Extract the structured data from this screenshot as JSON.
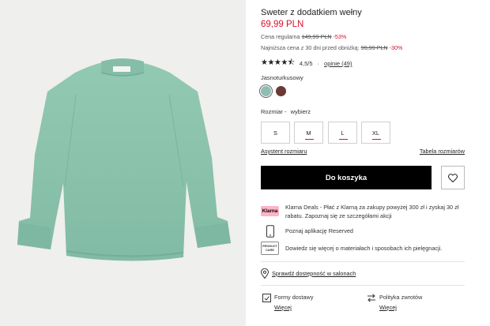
{
  "product": {
    "title": "Sweter z dodatkiem wełny",
    "price": "69,99 PLN",
    "regular_label": "Cena regularna",
    "regular_price": "149,99 PLN",
    "regular_discount": "-53%",
    "lowest_label": "Najniższa cena z 30 dni przed obniżką:",
    "lowest_price": "99,99 PLN",
    "lowest_discount": "-30%",
    "rating_value": "4,5/5",
    "rating_sep": "·",
    "reviews_link": "opinie (49)",
    "stars": "★★★★⯪"
  },
  "colors": {
    "selected_name": "Jasnoturkusowy",
    "swatches": [
      "#8fbdb2",
      "#6b3a34"
    ]
  },
  "sizes": {
    "label": "Rozmiar -",
    "hint": "wybierz",
    "options": [
      "S",
      "M",
      "L",
      "XL"
    ]
  },
  "links": {
    "size_assistant": "Asystent rozmiaru",
    "size_chart": "Tabela rozmiarów"
  },
  "cart": {
    "button_label": "Do koszyka"
  },
  "info": {
    "klarna_logo": "Klarna",
    "klarna_text": "Klarna Deals - Płać z Klarną za zakupy powyżej 300 zł i zyskaj 30 zł rabatu. Zapoznaj się ze szczegółami akcji",
    "app_text": "Poznaj aplikację Reserved",
    "care_icon_line1": "PRODUCT",
    "care_icon_line2": "CARE",
    "care_text": "Dowiedz się więcej o materiałach i sposobach ich pielęgnacji."
  },
  "store": {
    "availability_link": "Sprawdź dostępność w salonach"
  },
  "delivery": {
    "title": "Formy dostawy",
    "link": "Więcej"
  },
  "returns": {
    "title": "Polityka zwrotów",
    "link": "Więcej"
  },
  "theme": {
    "sale_red": "#d6122e",
    "sweater": "#8cc4ad"
  }
}
